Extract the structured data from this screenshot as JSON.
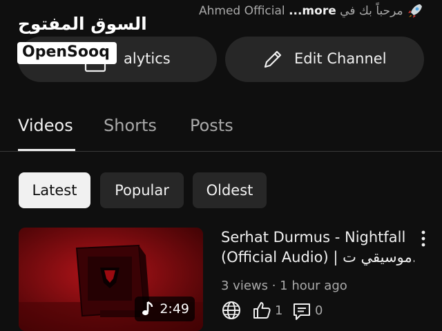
{
  "description": {
    "text_prefix": "مرحباً بك في",
    "more_label": "...more",
    "text_suffix": "Ahmed Official"
  },
  "watermark": {
    "arabic": "السوق المفتوح",
    "latin": "OpenSooq"
  },
  "actions": {
    "analytics_label": "Analytics",
    "analytics_visible_label": "alytics",
    "edit_channel_label": "Edit Channel"
  },
  "tabs": [
    {
      "label": "Videos",
      "active": true
    },
    {
      "label": "Shorts",
      "active": false
    },
    {
      "label": "Posts",
      "active": false
    }
  ],
  "chips": [
    {
      "label": "Latest",
      "selected": true
    },
    {
      "label": "Popular",
      "selected": false
    },
    {
      "label": "Oldest",
      "selected": false
    }
  ],
  "video": {
    "title_line1": "Serhat Durmus - Nightfall",
    "title_line2": "(Official Audio) | موسيقي ت...",
    "meta": "3 views · 1 hour ago",
    "duration": "2:49",
    "likes": "1",
    "comments": "0"
  },
  "colors": {
    "background": "#0f0f0f",
    "surface": "#272727",
    "text": "#f1f1f1",
    "secondary_text": "#aaaaaa",
    "thumbnail_red": "#8b0a0c"
  },
  "icons": [
    "rocket-icon",
    "bar-chart-icon",
    "pencil-icon",
    "music-note-icon",
    "more-vert-icon",
    "globe-icon",
    "thumb-up-icon",
    "comment-icon"
  ]
}
